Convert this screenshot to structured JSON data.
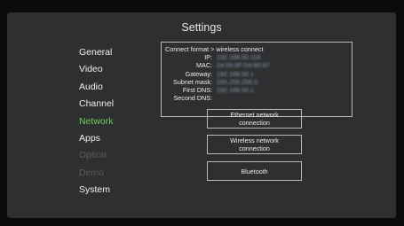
{
  "title": "Settings",
  "menu": {
    "items": [
      {
        "label": "General",
        "state": "normal"
      },
      {
        "label": "Video",
        "state": "normal"
      },
      {
        "label": "Audio",
        "state": "normal"
      },
      {
        "label": "Channel",
        "state": "normal"
      },
      {
        "label": "Network",
        "state": "active"
      },
      {
        "label": "Apps",
        "state": "normal"
      },
      {
        "label": "Option",
        "state": "disabled"
      },
      {
        "label": "Demo",
        "state": "disabled"
      },
      {
        "label": "System",
        "state": "normal"
      }
    ]
  },
  "network_info": {
    "header": "Connect format > wireless connect",
    "rows": [
      {
        "label": "IP:",
        "value": "192.168.50.118"
      },
      {
        "label": "MAC:",
        "value": "24:05:0F:D4:80:97"
      },
      {
        "label": "Gateway:",
        "value": "192.168.50.1"
      },
      {
        "label": "Subnet mask:",
        "value": "255.255.255.0"
      },
      {
        "label": "First DNS:",
        "value": "192.168.50.1"
      },
      {
        "label": "Second DNS:",
        "value": ""
      }
    ]
  },
  "buttons": {
    "ethernet": "Ethernet network\nconnection",
    "wireless": "Wireless network\nconnection",
    "bluetooth": "Bluetooth"
  },
  "colors": {
    "active": "#6fcf57",
    "disabled": "#5a5b5d",
    "panel": "#2e2f31"
  }
}
